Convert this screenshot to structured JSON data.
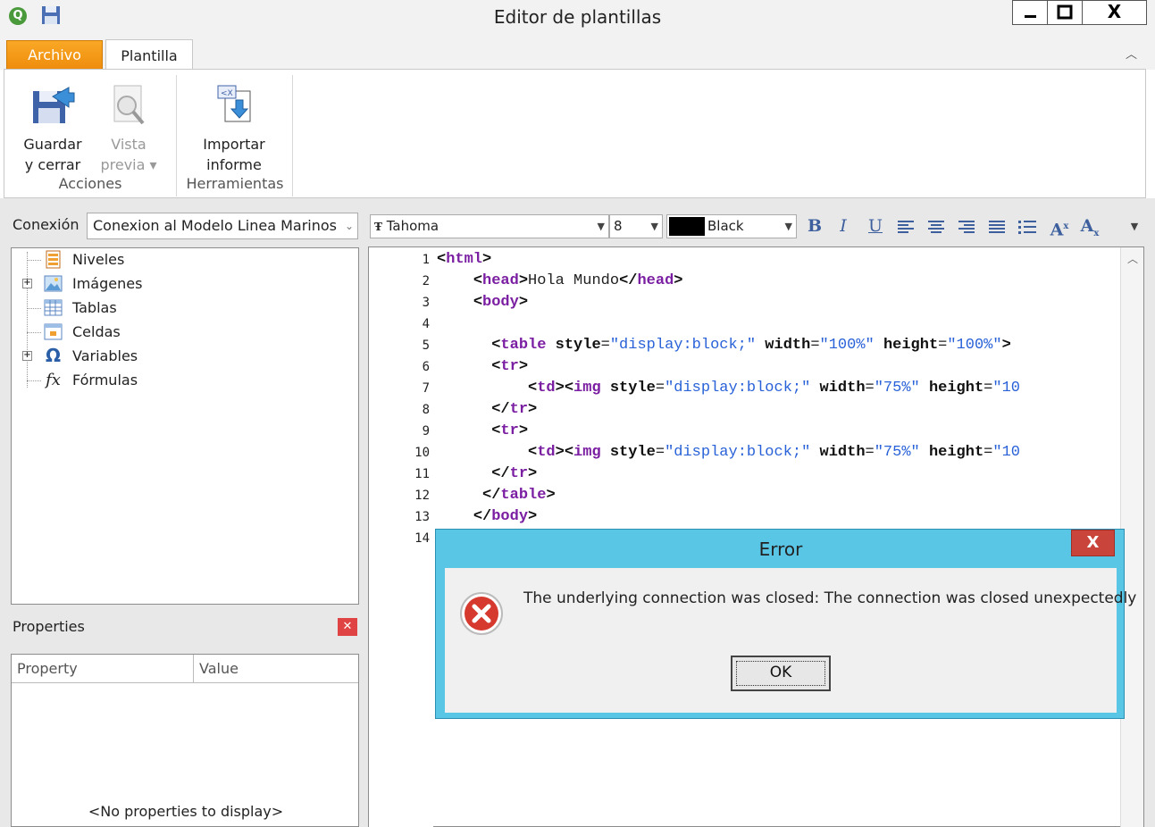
{
  "window": {
    "title": "Editor de plantillas",
    "controls": {
      "minimize": "_",
      "maximize": "□",
      "close": "X"
    }
  },
  "ribbon": {
    "tabs": [
      "Archivo",
      "Plantilla"
    ],
    "active_tab": "Plantilla",
    "groups": [
      {
        "label": "Acciones",
        "buttons": [
          {
            "label": "Guardar\ny cerrar",
            "icon": "save-close-icon",
            "enabled": true
          },
          {
            "label": "Vista\nprevia ▾",
            "icon": "preview-icon",
            "enabled": false
          }
        ]
      },
      {
        "label": "Herramientas",
        "buttons": [
          {
            "label": "Importar\ninforme",
            "icon": "import-report-icon",
            "enabled": true
          }
        ]
      }
    ]
  },
  "connection": {
    "label": "Conexión",
    "value": "Conexion al Modelo Linea Marinos"
  },
  "tree": [
    {
      "label": "Niveles",
      "icon": "levels-icon",
      "expandable": false
    },
    {
      "label": "Imágenes",
      "icon": "images-icon",
      "expandable": true
    },
    {
      "label": "Tablas",
      "icon": "tables-icon",
      "expandable": false
    },
    {
      "label": "Celdas",
      "icon": "cells-icon",
      "expandable": false
    },
    {
      "label": "Variables",
      "icon": "omega-icon",
      "expandable": true
    },
    {
      "label": "Fórmulas",
      "icon": "fx-icon",
      "expandable": false
    }
  ],
  "properties": {
    "title": "Properties",
    "columns": [
      "Property",
      "Value"
    ],
    "empty_text": "<No properties to display>"
  },
  "format_toolbar": {
    "font": "Tahoma",
    "size": "8",
    "color_name": "Black",
    "color_hex": "#000000",
    "buttons": [
      "B",
      "I",
      "U",
      "align-left",
      "align-center",
      "align-right",
      "justify",
      "list",
      "superscript",
      "subscript"
    ]
  },
  "editor": {
    "line_numbers": [
      "1",
      "2",
      "3",
      "4",
      "5",
      "6",
      "7",
      "8",
      "9",
      "10",
      "11",
      "12",
      "13",
      "14"
    ],
    "lines": [
      "<html>",
      "    <head>Hola Mundo</head>",
      "    <body>",
      "",
      "      <table style=\"display:block;\" width=\"100%\" height=\"100%\">",
      "      <tr>",
      "          <td><img style=\"display:block;\" width=\"75%\" height=\"10",
      "      </tr>",
      "      <tr>",
      "          <td><img style=\"display:block;\" width=\"75%\" height=\"10",
      "      </tr>",
      "     </table>",
      "    </body>",
      ""
    ]
  },
  "error_dialog": {
    "title": "Error",
    "message": "The underlying connection was closed: The connection was closed unexpectedly",
    "ok_label": "OK",
    "close_label": "X"
  }
}
